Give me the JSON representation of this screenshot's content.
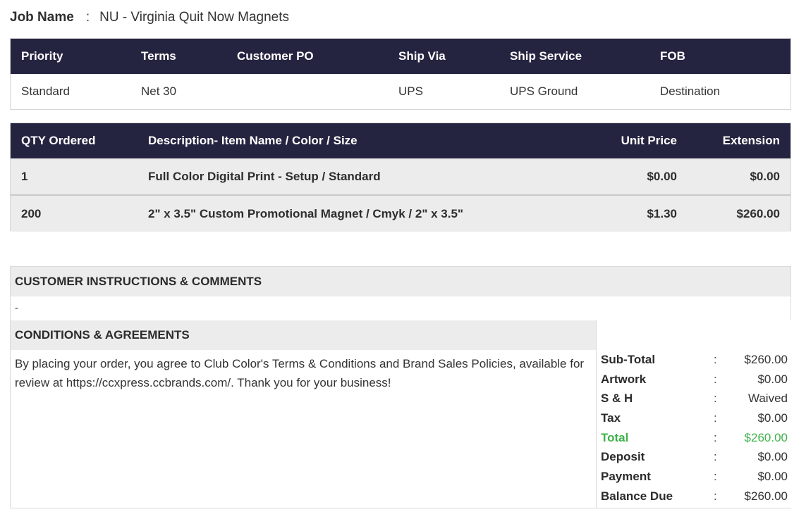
{
  "job": {
    "label": "Job Name",
    "colon": ":",
    "value": "NU - Virginia Quit Now Magnets"
  },
  "order_info": {
    "headers": [
      "Priority",
      "Terms",
      "Customer PO",
      "Ship Via",
      "Ship Service",
      "FOB"
    ],
    "values": [
      "Standard",
      "Net 30",
      "",
      "UPS",
      "UPS Ground",
      "Destination"
    ]
  },
  "items": {
    "headers": [
      "QTY Ordered",
      "Description- Item Name / Color / Size",
      "Unit Price",
      "Extension"
    ],
    "rows": [
      [
        "1",
        "Full Color Digital Print - Setup / Standard",
        "$0.00",
        "$0.00"
      ],
      [
        "200",
        "2\" x 3.5\" Custom Promotional Magnet / Cmyk / 2\" x 3.5\"",
        "$1.30",
        "$260.00"
      ]
    ]
  },
  "instructions": {
    "title": "CUSTOMER INSTRUCTIONS & COMMENTS",
    "text": "-"
  },
  "conditions": {
    "title": "CONDITIONS & AGREEMENTS",
    "text": "By placing your order, you agree to Club Color's Terms & Conditions and Brand Sales Policies, available for review at https://ccxpress.ccbrands.com/. Thank you for your business!"
  },
  "totals": {
    "colon": ":",
    "rows": [
      {
        "label": "Sub-Total",
        "value": "$260.00"
      },
      {
        "label": "Artwork",
        "value": "$0.00"
      },
      {
        "label": "S & H",
        "value": "Waived"
      },
      {
        "label": "Tax",
        "value": "$0.00"
      },
      {
        "label": "Total",
        "value": "$260.00"
      },
      {
        "label": "Deposit",
        "value": "$0.00"
      },
      {
        "label": "Payment",
        "value": "$0.00"
      },
      {
        "label": "Balance Due",
        "value": "$260.00"
      }
    ],
    "total_color": "#3fb24a"
  },
  "colors": {
    "header_bg": "#252440",
    "row_bg": "#ececec"
  }
}
